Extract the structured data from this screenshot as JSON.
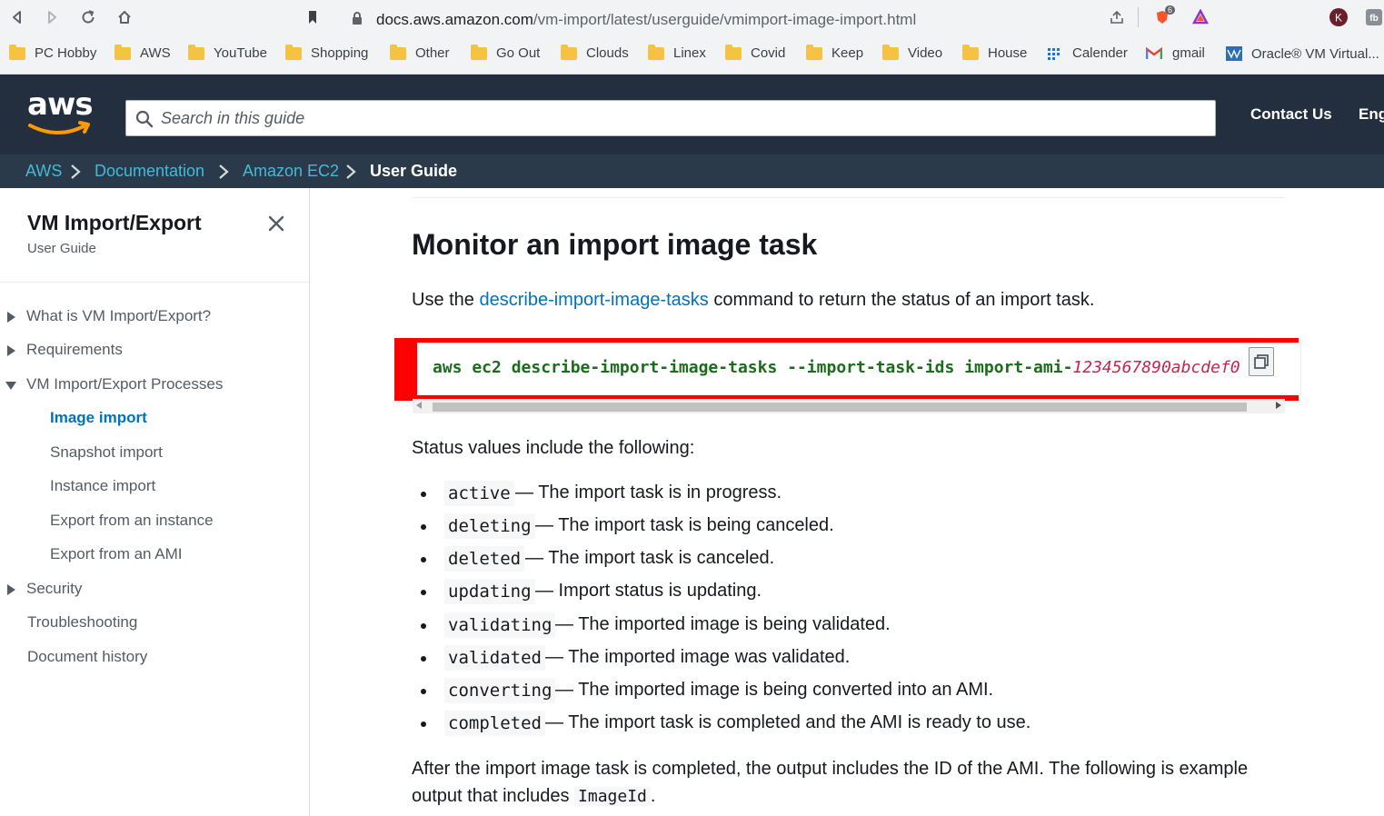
{
  "browser": {
    "url_host": "docs.aws.amazon.com",
    "url_path": "/vm-import/latest/userguide/vmimport-image-import.html",
    "badge_count": "6"
  },
  "bookmarks": [
    "PC Hobby",
    "AWS",
    "YouTube",
    "Shopping",
    "Other",
    "Go Out",
    "Clouds",
    "Linex",
    "Covid",
    "Keep",
    "Video",
    "House",
    "Calender",
    "gmail",
    "Oracle® VM Virtual..."
  ],
  "header": {
    "logo": "aws",
    "search_placeholder": "Search in this guide",
    "contact": "Contact Us",
    "lang": "Eng"
  },
  "breadcrumb": [
    "AWS",
    "Documentation",
    "Amazon EC2",
    "User Guide"
  ],
  "sidebar": {
    "title": "VM Import/Export",
    "subtitle": "User Guide",
    "items": [
      {
        "label": "What is VM Import/Export?"
      },
      {
        "label": "Requirements"
      },
      {
        "label": "VM Import/Export Processes"
      },
      {
        "label": "Image import"
      },
      {
        "label": "Snapshot import"
      },
      {
        "label": "Instance import"
      },
      {
        "label": "Export from an instance"
      },
      {
        "label": "Export from an AMI"
      },
      {
        "label": "Security"
      },
      {
        "label": "Troubleshooting"
      },
      {
        "label": "Document history"
      }
    ]
  },
  "main": {
    "title": "Monitor an import image task",
    "intro_pre": "Use the ",
    "intro_link": "describe-import-image-tasks",
    "intro_post": " command to return the status of an import task.",
    "code_cmd": "aws ec2 describe-import-image-tasks --import-task-ids import-ami-",
    "code_arg": "1234567890abcdef0",
    "status_intro": "Status values include the following:",
    "statuses": [
      {
        "code": "active",
        "desc": "— The import task is in progress."
      },
      {
        "code": "deleting",
        "desc": "— The import task is being canceled."
      },
      {
        "code": "deleted",
        "desc": "— The import task is canceled."
      },
      {
        "code": "updating",
        "desc": "— Import status is updating."
      },
      {
        "code": "validating",
        "desc": "— The imported image is being validated."
      },
      {
        "code": "validated",
        "desc": "— The imported image was validated."
      },
      {
        "code": "converting",
        "desc": "— The imported image is being converted into an AMI."
      },
      {
        "code": "completed",
        "desc": "— The import task is completed and the AMI is ready to use."
      }
    ],
    "outro_line1": "After the import image task is completed, the output includes the ID of the AMI. The following is example",
    "outro_line2_pre": "output that includes ",
    "outro_code": "ImageId",
    "outro_line2_post": "."
  }
}
